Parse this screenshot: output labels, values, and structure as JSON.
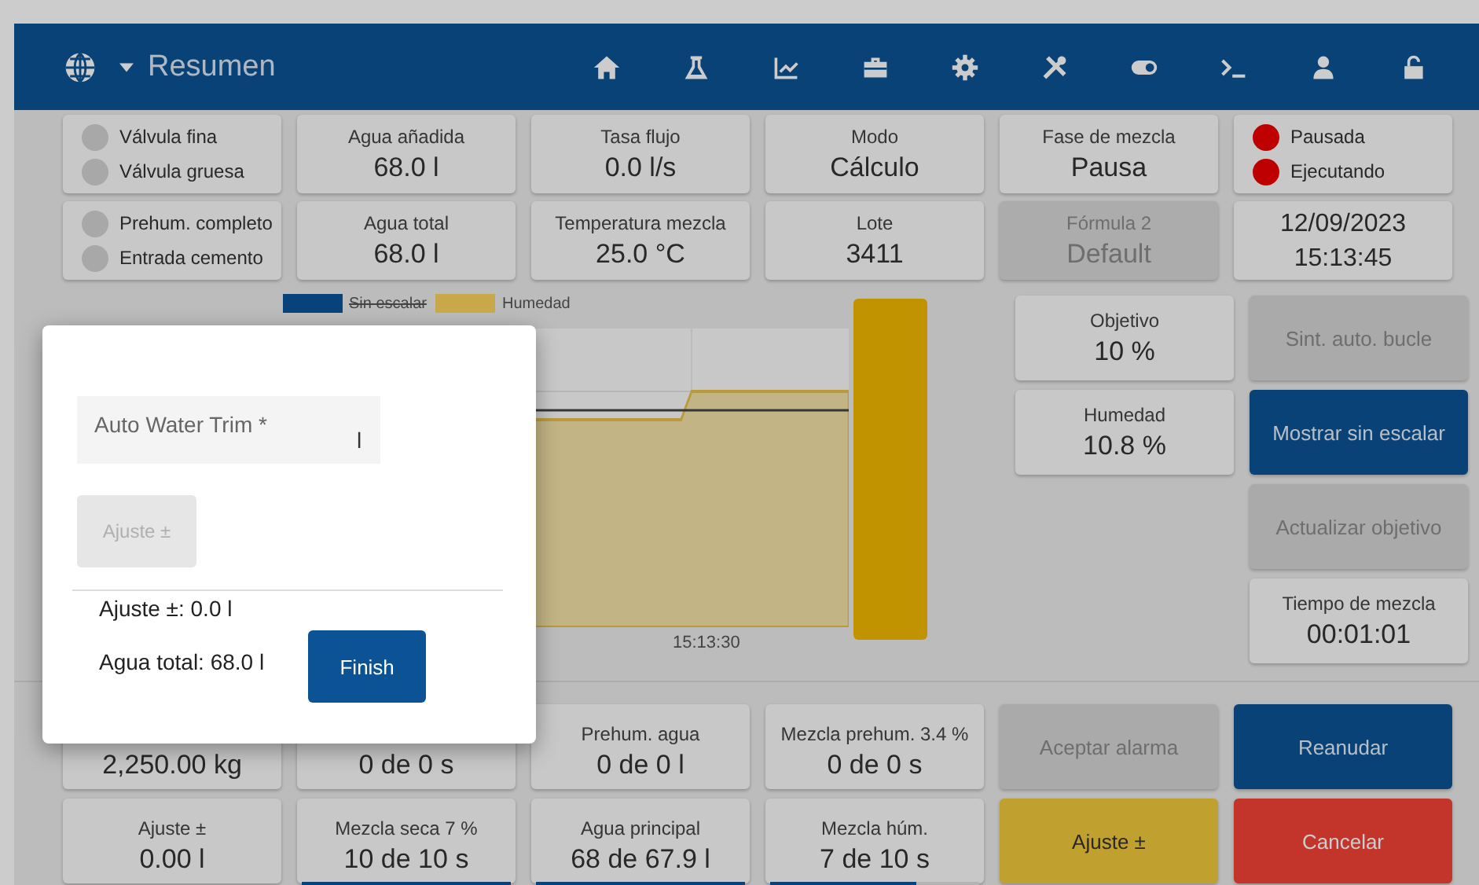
{
  "header": {
    "title": "Resumen"
  },
  "top_cells": [
    {
      "kind": "lights",
      "lights": [
        {
          "label": "Válvula fina",
          "on": false
        },
        {
          "label": "Válvula gruesa",
          "on": false
        }
      ]
    },
    {
      "kind": "value",
      "label": "Agua añadida",
      "value": "68.0 l",
      "disabled": false
    },
    {
      "kind": "value",
      "label": "Tasa flujo",
      "value": "0.0 l/s",
      "disabled": false
    },
    {
      "kind": "value",
      "label": "Modo",
      "value": "Cálculo",
      "disabled": false
    },
    {
      "kind": "value",
      "label": "Fase de mezcla",
      "value": "Pausa",
      "disabled": false
    },
    {
      "kind": "lights",
      "lights": [
        {
          "label": "Pausada",
          "on": true
        },
        {
          "label": "Ejecutando",
          "on": true
        }
      ]
    },
    {
      "kind": "lights",
      "lights": [
        {
          "label": "Prehum. completo",
          "on": false
        },
        {
          "label": "Entrada cemento",
          "on": false
        }
      ]
    },
    {
      "kind": "value",
      "label": "Agua total",
      "value": "68.0 l",
      "disabled": false
    },
    {
      "kind": "value",
      "label": "Temperatura mezcla",
      "value": "25.0 °C",
      "disabled": false
    },
    {
      "kind": "value",
      "label": "Lote",
      "value": "3411",
      "disabled": false
    },
    {
      "kind": "value",
      "label": "Fórmula 2",
      "value": "Default",
      "disabled": true
    },
    {
      "kind": "datetime",
      "date": "12/09/2023",
      "time": "15:13:45"
    }
  ],
  "chart": {
    "legend": [
      {
        "label": "Sin escalar",
        "color": "#08427a",
        "hidden": true
      },
      {
        "label": "Humedad",
        "color": "#c8a848",
        "hidden": false
      }
    ],
    "x_tick": "15:13:30"
  },
  "side_cards": [
    {
      "label": "Objetivo",
      "value": "10 %"
    },
    {
      "label": "Humedad",
      "value": "10.8 %"
    }
  ],
  "side_items": [
    {
      "kind": "button",
      "label": "Sint. auto. bucle",
      "disabled": true
    },
    {
      "kind": "primary-button",
      "label": "Mostrar sin escalar",
      "disabled": false
    },
    {
      "kind": "button",
      "label": "Actualizar objetivo",
      "disabled": true
    },
    {
      "kind": "value",
      "label": "Tiempo de mezcla",
      "value": "00:01:01",
      "disabled": false
    }
  ],
  "bottom_cells": [
    {
      "kind": "value",
      "value": "2,250.00 kg",
      "disabled": false
    },
    {
      "kind": "value",
      "value": "0 de 0 s",
      "disabled": false
    },
    {
      "kind": "value",
      "label": "Prehum. agua",
      "value": "0 de 0 l",
      "disabled": false
    },
    {
      "kind": "value",
      "label": "Mezcla prehum. 3.4 %",
      "value": "0 de 0 s",
      "disabled": false
    },
    {
      "kind": "button",
      "label": "Aceptar alarma",
      "disabled": true
    },
    {
      "kind": "primary-button",
      "label": "Reanudar",
      "disabled": false
    },
    {
      "kind": "value",
      "label": "Ajuste ±",
      "value": "0.00 l",
      "disabled": false
    },
    {
      "kind": "value",
      "label": "Mezcla seca 7 %",
      "value": "10 de 10 s",
      "disabled": false,
      "level": 1
    },
    {
      "kind": "value",
      "label": "Agua principal",
      "value": "68 de 67.9 l",
      "disabled": false,
      "level": 1
    },
    {
      "kind": "value",
      "label": "Mezcla húm.",
      "value": "7 de 10 s",
      "disabled": false,
      "level": 0.7
    },
    {
      "kind": "warning-button",
      "label": "Ajuste ±",
      "disabled": false
    },
    {
      "kind": "danger-button",
      "label": "Cancelar",
      "disabled": false
    }
  ],
  "dialog": {
    "field": {
      "label": "Auto Water Trim *",
      "suffix": "l"
    },
    "adjust_button": {
      "label": "Ajuste ±",
      "disabled": true
    },
    "lines": [
      "Ajuste ±: 0.0 l",
      "Agua total: 68.0 l"
    ],
    "finish_button": "Finish"
  }
}
